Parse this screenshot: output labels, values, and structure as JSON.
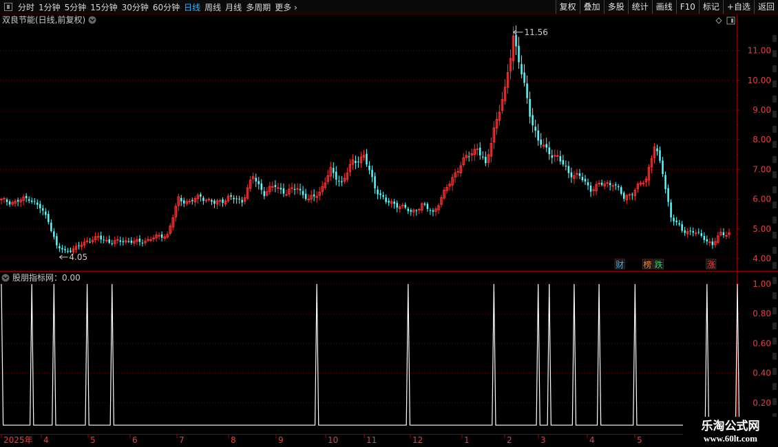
{
  "toolbar": {
    "periods": [
      "分时",
      "1分钟",
      "5分钟",
      "15分钟",
      "30分钟",
      "60分钟",
      "日线",
      "周线",
      "月线",
      "多周期",
      "更多"
    ],
    "active_period": "日线",
    "buttons": [
      "复权",
      "叠加",
      "多股",
      "统计",
      "画线",
      "F10",
      "标记",
      "+自选",
      "返回"
    ]
  },
  "main_panel": {
    "title": "双良节能(日线,前复权)",
    "high_label": "11.56",
    "low_label": "4.05",
    "event_tags": [
      {
        "text": "财",
        "color": "#3ab4ff",
        "x_index": 222
      },
      {
        "text": "榜",
        "color": "#ff8a3a",
        "x_index": 232
      },
      {
        "text": "跌",
        "color": "#40d060",
        "x_index": 236
      },
      {
        "text": "涨",
        "color": "#ff4040",
        "x_index": 255
      }
    ],
    "price_axis": [
      "11.00",
      "10.00",
      "9.00",
      "8.00",
      "7.00",
      "6.00",
      "5.00",
      "4.00"
    ]
  },
  "sub_panel": {
    "title": "股朋指标网：0.00",
    "axis": [
      "1.00",
      "0.80",
      "0.60",
      "0.40",
      "0.20"
    ]
  },
  "time_axis": [
    "2025年",
    "4",
    "5",
    "6",
    "7",
    "8",
    "9",
    "10",
    "11",
    "12",
    "1",
    "2",
    "3",
    "4",
    "5"
  ],
  "watermark": {
    "line1": "乐淘公式网",
    "line2": "www.60lt.com"
  },
  "chart_data": {
    "type": "candlestick",
    "y_range": [
      3.7,
      11.8
    ],
    "close_anchors": [
      [
        0,
        5.95
      ],
      [
        5,
        5.9
      ],
      [
        10,
        6.05
      ],
      [
        14,
        5.7
      ],
      [
        17,
        5.3
      ],
      [
        20,
        4.4
      ],
      [
        23,
        4.25
      ],
      [
        27,
        4.35
      ],
      [
        31,
        4.6
      ],
      [
        35,
        4.7
      ],
      [
        40,
        4.55
      ],
      [
        45,
        4.6
      ],
      [
        50,
        4.55
      ],
      [
        55,
        4.7
      ],
      [
        60,
        4.8
      ],
      [
        64,
        6.0
      ],
      [
        68,
        5.9
      ],
      [
        72,
        6.1
      ],
      [
        77,
        5.85
      ],
      [
        82,
        6.05
      ],
      [
        87,
        5.95
      ],
      [
        91,
        6.75
      ],
      [
        95,
        6.2
      ],
      [
        99,
        6.45
      ],
      [
        103,
        6.2
      ],
      [
        107,
        6.4
      ],
      [
        111,
        5.95
      ],
      [
        115,
        6.25
      ],
      [
        119,
        6.95
      ],
      [
        123,
        6.55
      ],
      [
        127,
        7.25
      ],
      [
        131,
        7.45
      ],
      [
        135,
        6.4
      ],
      [
        139,
        5.9
      ],
      [
        144,
        5.8
      ],
      [
        148,
        5.55
      ],
      [
        152,
        5.8
      ],
      [
        156,
        5.55
      ],
      [
        160,
        6.2
      ],
      [
        164,
        6.9
      ],
      [
        168,
        7.4
      ],
      [
        172,
        7.75
      ],
      [
        175,
        7.1
      ],
      [
        178,
        8.4
      ],
      [
        182,
        9.6
      ],
      [
        185,
        11.55
      ],
      [
        188,
        10.2
      ],
      [
        191,
        8.9
      ],
      [
        194,
        7.95
      ],
      [
        197,
        7.65
      ],
      [
        201,
        7.4
      ],
      [
        205,
        6.9
      ],
      [
        209,
        6.75
      ],
      [
        213,
        6.35
      ],
      [
        217,
        6.5
      ],
      [
        221,
        6.55
      ],
      [
        225,
        6.05
      ],
      [
        229,
        6.3
      ],
      [
        233,
        6.7
      ],
      [
        236,
        7.8
      ],
      [
        239,
        6.9
      ],
      [
        242,
        5.4
      ],
      [
        246,
        4.95
      ],
      [
        250,
        4.9
      ],
      [
        254,
        4.7
      ],
      [
        257,
        4.45
      ],
      [
        260,
        4.85
      ],
      [
        263,
        4.85
      ]
    ],
    "candle_count": 264,
    "signal_spike_indices": [
      0,
      11,
      19,
      31,
      40,
      114,
      147,
      178,
      194,
      198,
      207,
      216,
      229,
      255,
      266
    ],
    "signal_range": [
      0,
      1
    ],
    "signal_baseline": 0.05
  }
}
